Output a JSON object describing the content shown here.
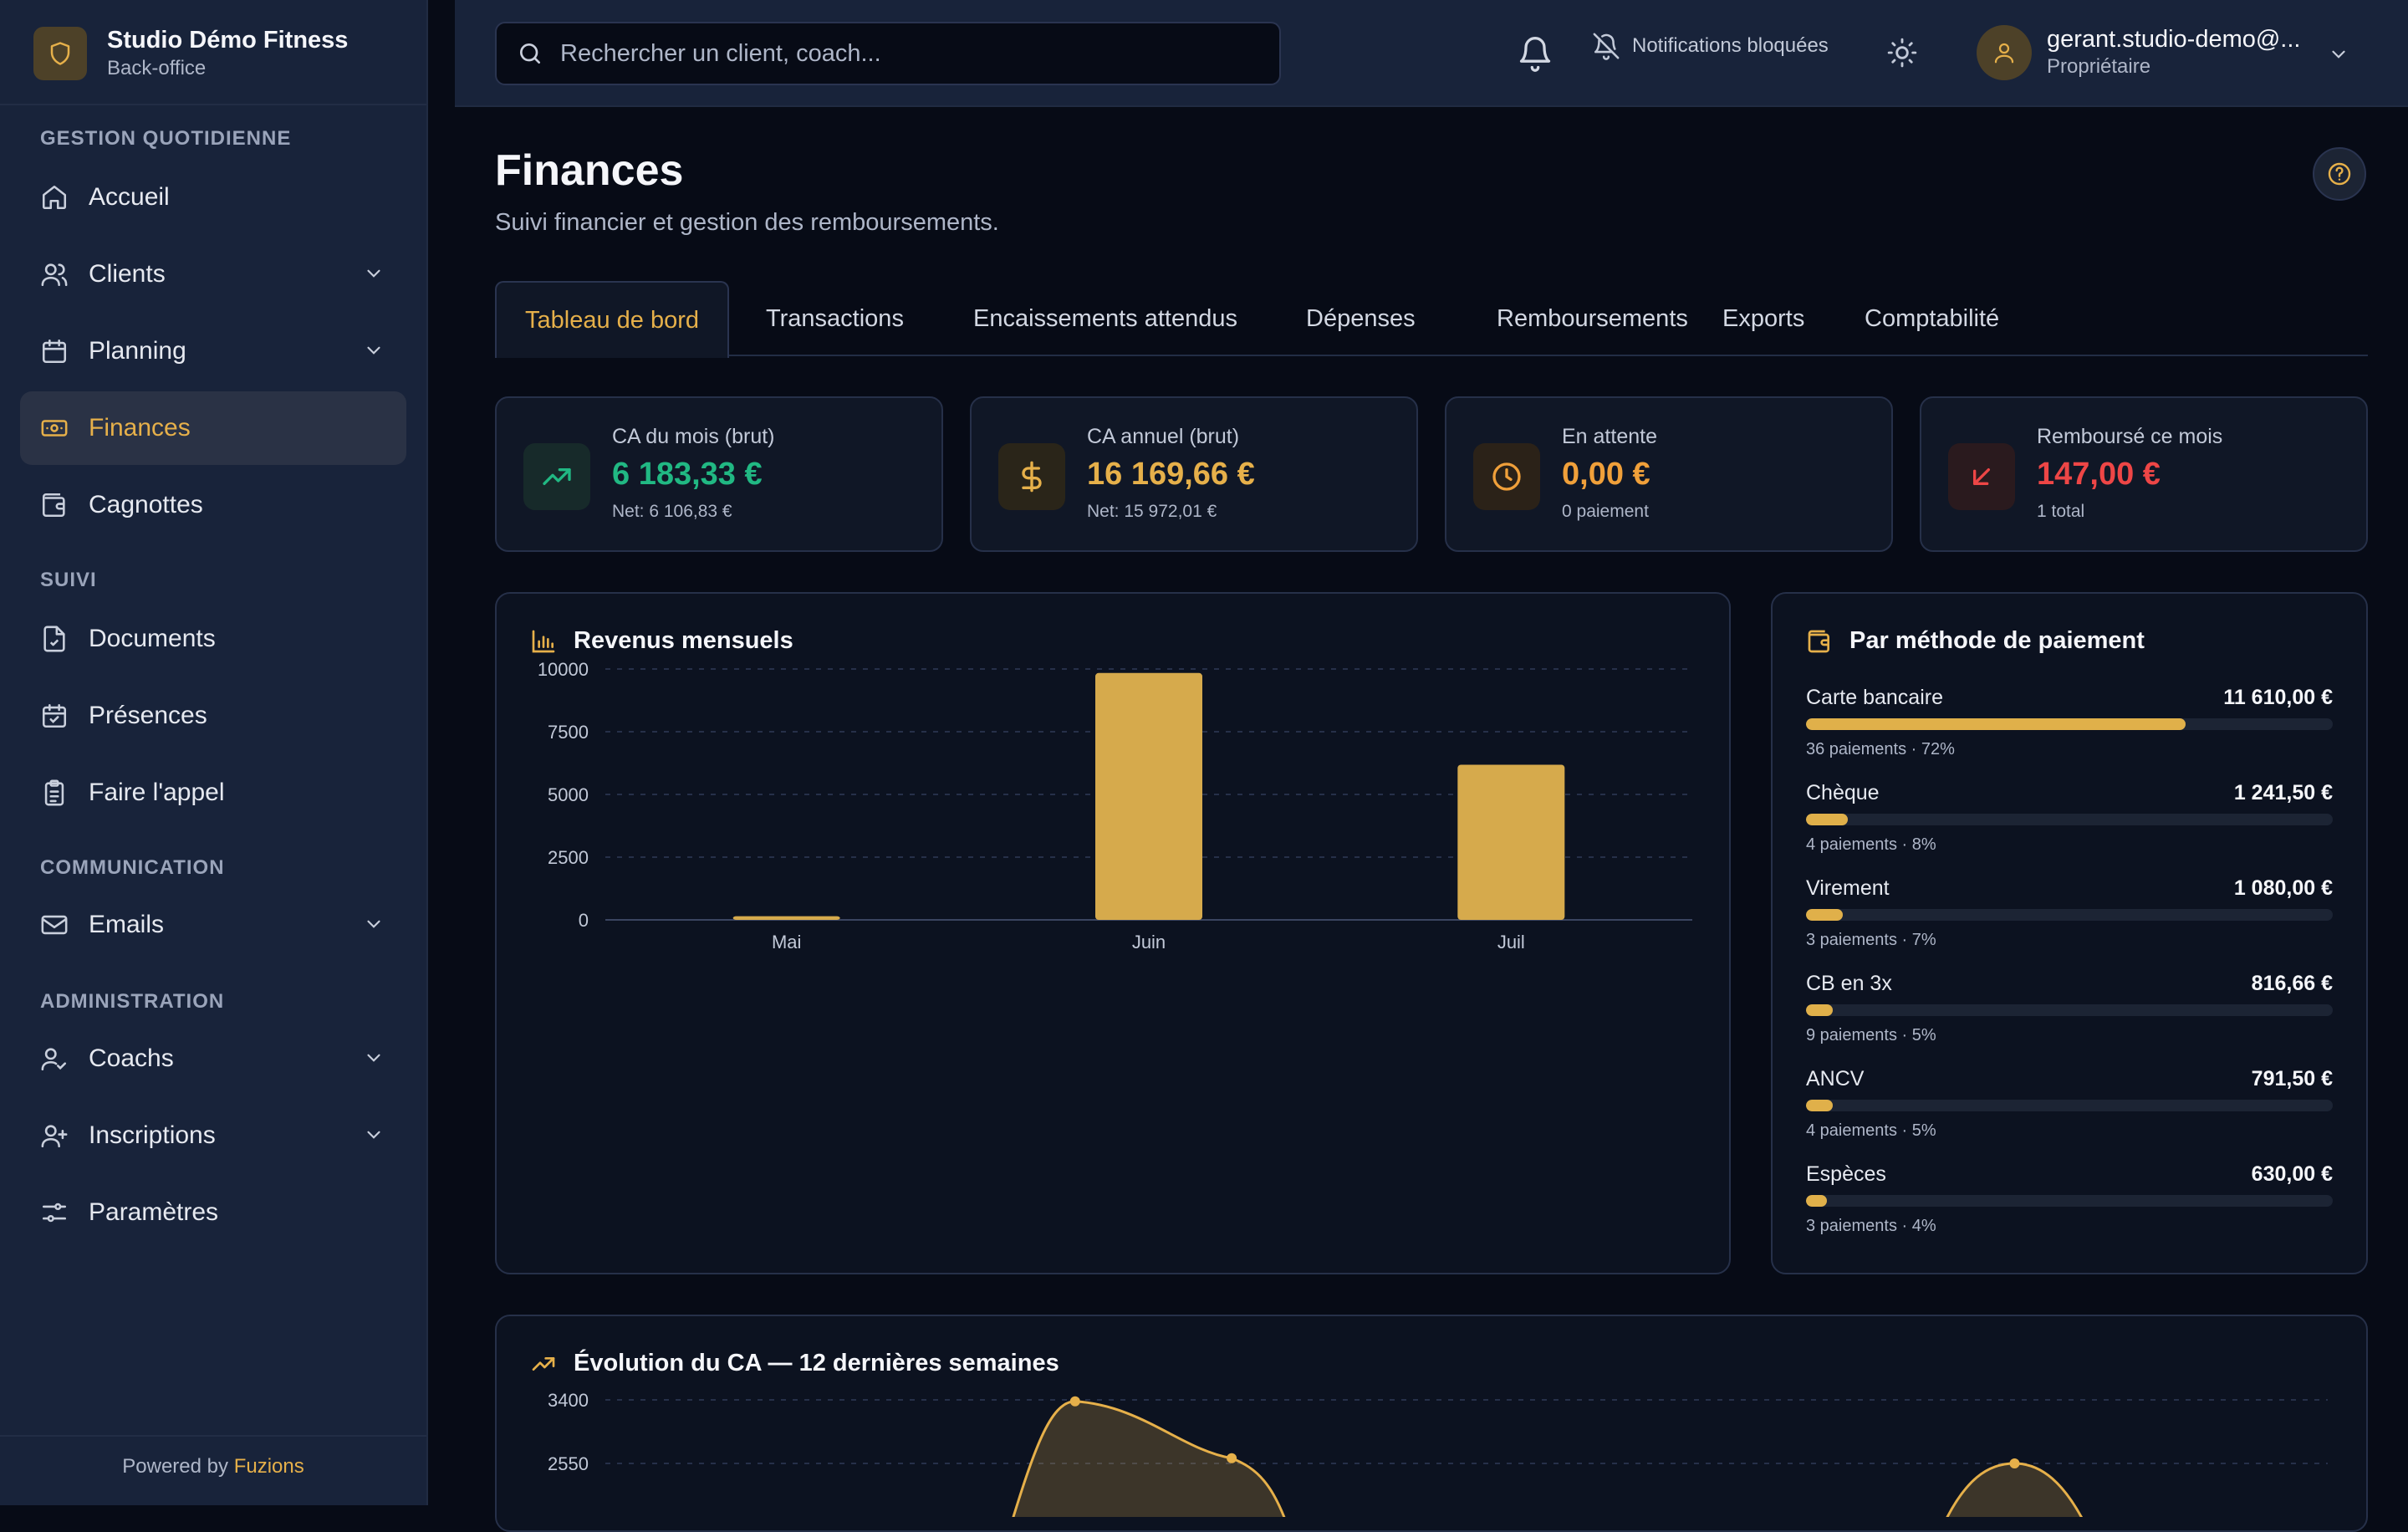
{
  "brand": {
    "name": "Studio Démo Fitness",
    "subtitle": "Back-office"
  },
  "sidebar": {
    "sections": [
      "GESTION QUOTIDIENNE",
      "SUIVI",
      "COMMUNICATION",
      "ADMINISTRATION"
    ],
    "items": [
      {
        "label": "Accueil",
        "icon": "home-icon",
        "expandable": false
      },
      {
        "label": "Clients",
        "icon": "users-icon",
        "expandable": true
      },
      {
        "label": "Planning",
        "icon": "calendar-icon",
        "expandable": true
      },
      {
        "label": "Finances",
        "icon": "banknote-icon",
        "expandable": false,
        "active": true
      },
      {
        "label": "Cagnottes",
        "icon": "wallet-icon",
        "expandable": false
      },
      {
        "label": "Documents",
        "icon": "file-icon",
        "expandable": false
      },
      {
        "label": "Présences",
        "icon": "calendar-check-icon",
        "expandable": false
      },
      {
        "label": "Faire l'appel",
        "icon": "clipboard-icon",
        "expandable": false
      },
      {
        "label": "Emails",
        "icon": "mail-icon",
        "expandable": true
      },
      {
        "label": "Coachs",
        "icon": "user-check-icon",
        "expandable": true
      },
      {
        "label": "Inscriptions",
        "icon": "user-plus-icon",
        "expandable": true
      },
      {
        "label": "Paramètres",
        "icon": "sliders-icon",
        "expandable": false
      }
    ],
    "footer_prefix": "Powered by",
    "footer_brand": "Fuzions"
  },
  "topbar": {
    "search_placeholder": "Rechercher un client, coach...",
    "notifications_label": "Notifications bloquées",
    "user_name": "gerant.studio-demo@...",
    "user_role": "Propriétaire"
  },
  "page": {
    "title": "Finances",
    "subtitle": "Suivi financier et gestion des remboursements."
  },
  "tabs": [
    "Tableau de bord",
    "Transactions",
    "Encaissements attendus",
    "Dépenses",
    "Remboursements",
    "Exports",
    "Comptabilité"
  ],
  "stats": [
    {
      "label": "CA du mois (brut)",
      "value": "6 183,33 €",
      "note": "Net: 6 106,83 €",
      "color": "#21b883",
      "icon": "trending-up-icon"
    },
    {
      "label": "CA annuel (brut)",
      "value": "16 169,66 €",
      "note": "Net: 15 972,01 €",
      "color": "#e6b04a",
      "icon": "dollar-icon"
    },
    {
      "label": "En attente",
      "value": "0,00 €",
      "note": "0 paiement",
      "color": "#f0a03a",
      "icon": "clock-icon"
    },
    {
      "label": "Remboursé ce mois",
      "value": "147,00 €",
      "note": "1 total",
      "color": "#ee4646",
      "icon": "arrow-down-left-icon"
    }
  ],
  "revenue_card": {
    "title": "Revenus mensuels"
  },
  "payment_card": {
    "title": "Par méthode de paiement",
    "methods": [
      {
        "name": "Carte bancaire",
        "amount": "11 610,00 €",
        "detail": "36 paiements · 72%",
        "share": 0.72
      },
      {
        "name": "Chèque",
        "amount": "1 241,50 €",
        "detail": "4 paiements · 8%",
        "share": 0.08
      },
      {
        "name": "Virement",
        "amount": "1 080,00 €",
        "detail": "3 paiements · 7%",
        "share": 0.07
      },
      {
        "name": "CB en 3x",
        "amount": "816,66 €",
        "detail": "9 paiements · 5%",
        "share": 0.05
      },
      {
        "name": "ANCV",
        "amount": "791,50 €",
        "detail": "4 paiements · 5%",
        "share": 0.05
      },
      {
        "name": "Espèces",
        "amount": "630,00 €",
        "detail": "3 paiements · 4%",
        "share": 0.04
      }
    ]
  },
  "evolution_card": {
    "title": "Évolution du CA — 12 dernières semaines"
  },
  "chart_data": [
    {
      "type": "bar",
      "title": "Revenus mensuels",
      "categories": [
        "Mai",
        "Juin",
        "Juil"
      ],
      "values": [
        147,
        9840,
        6183
      ],
      "ylim": [
        0,
        10000
      ],
      "yticks": [
        0,
        2500,
        5000,
        7500,
        10000
      ],
      "grid": true,
      "color": "#d6aa4c"
    },
    {
      "type": "area",
      "title": "Évolution du CA — 12 dernières semaines",
      "note": "partially visible (cropped at bottom of screen)",
      "visible_yticks": [
        3400,
        2550
      ],
      "points_visible": [
        {
          "week_index": 3,
          "value": 3380
        },
        {
          "week_index": 4,
          "value": 2620
        },
        {
          "week_index": 9,
          "value": 2550
        }
      ],
      "color": "#e6b04a"
    }
  ]
}
